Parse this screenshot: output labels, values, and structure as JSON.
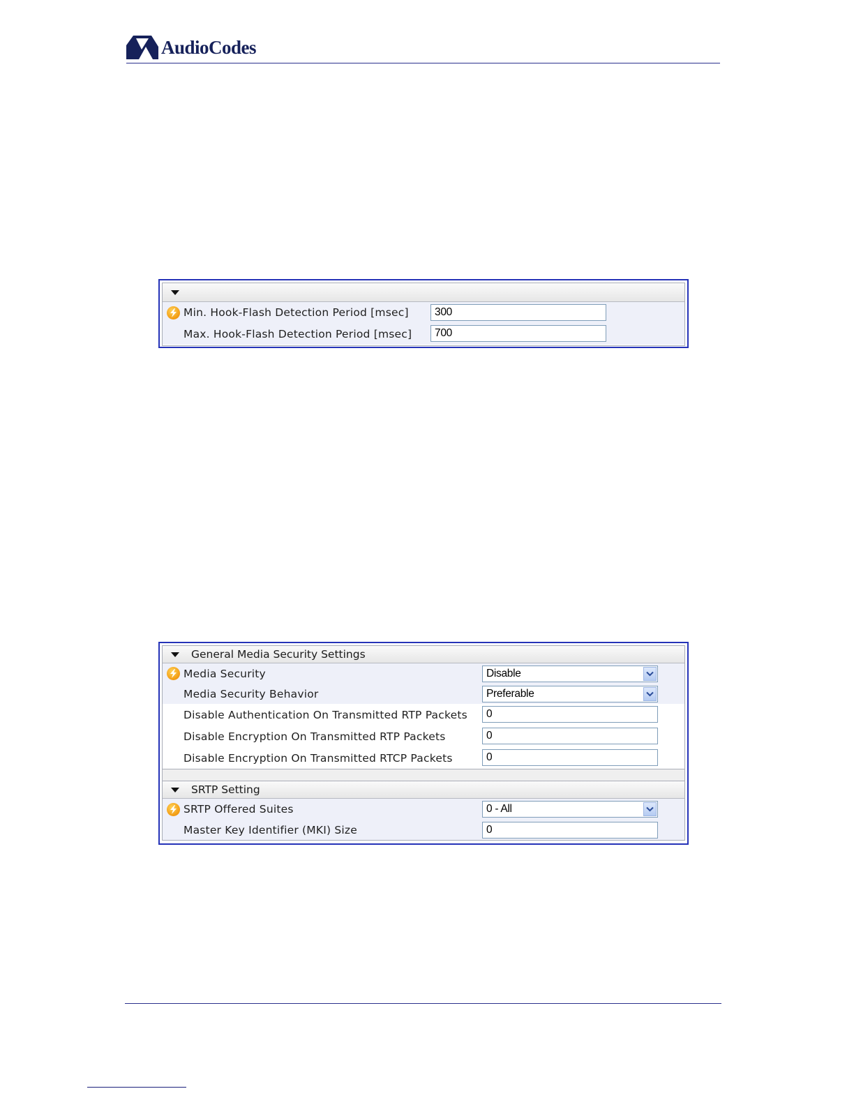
{
  "header": {
    "logo_text": "AudioCodes"
  },
  "hookflash_panel": {
    "section_title": "",
    "rows": [
      {
        "label": "Min. Hook-Flash Detection Period [msec]",
        "value": "300"
      },
      {
        "label": "Max. Hook-Flash Detection Period [msec]",
        "value": "700"
      }
    ]
  },
  "media_security_panel": {
    "general": {
      "title": "General Media Security Settings",
      "media_security": {
        "label": "Media Security",
        "value": "Disable"
      },
      "media_security_behavior": {
        "label": "Media Security Behavior",
        "value": "Preferable"
      },
      "disable_auth_rtp": {
        "label": "Disable Authentication On Transmitted RTP Packets",
        "value": "0"
      },
      "disable_enc_rtp": {
        "label": "Disable Encryption On Transmitted RTP Packets",
        "value": "0"
      },
      "disable_enc_rtcp": {
        "label": "Disable Encryption On Transmitted RTCP Packets",
        "value": "0"
      }
    },
    "srtp": {
      "title": "SRTP Setting",
      "offered_suites": {
        "label": "SRTP Offered Suites",
        "value": "0 - All"
      },
      "mki_size": {
        "label": "Master Key Identifier (MKI) Size",
        "value": "0"
      }
    }
  },
  "icons": {
    "flash": "lightning-bolt-icon",
    "collapse": "caret-down-icon",
    "dropdown": "chevron-down-icon"
  },
  "colors": {
    "brand": "#16215a",
    "panel_border": "#2533b8",
    "row_alt": "#eef0f9",
    "flash": "#f29a10"
  }
}
